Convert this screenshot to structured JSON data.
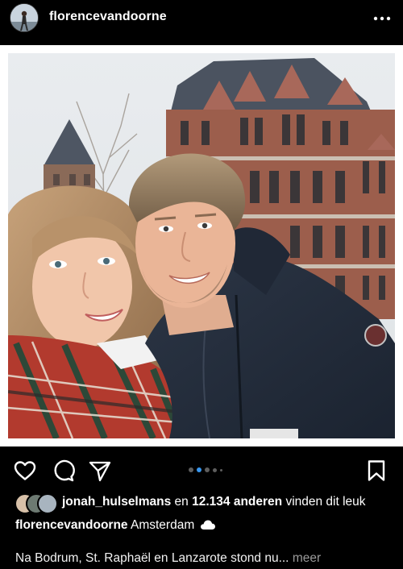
{
  "post": {
    "username": "florencevandoorne",
    "carousel": {
      "slides": 5,
      "active_index": 1
    }
  },
  "likes": {
    "liked_by_user": "jonah_hulselmans",
    "connector": "en",
    "count_text": "12.134 anderen",
    "suffix": "vinden dit leuk"
  },
  "caption": {
    "username": "florencevandoorne",
    "location": "Amsterdam",
    "weather_icon": "cloud-icon",
    "text": "Na Bodrum, St. Raphaël en Lanzarote stond nu...",
    "more_label": "meer"
  },
  "icons": {
    "more": "more-horizontal-icon",
    "like": "heart-icon",
    "comment": "comment-icon",
    "share": "send-icon",
    "save": "bookmark-icon"
  },
  "colors": {
    "background": "#000000",
    "text": "#ffffff",
    "muted": "#9a9a9a",
    "dot_inactive": "#5e5e5e",
    "dot_active": "#3897f0"
  }
}
